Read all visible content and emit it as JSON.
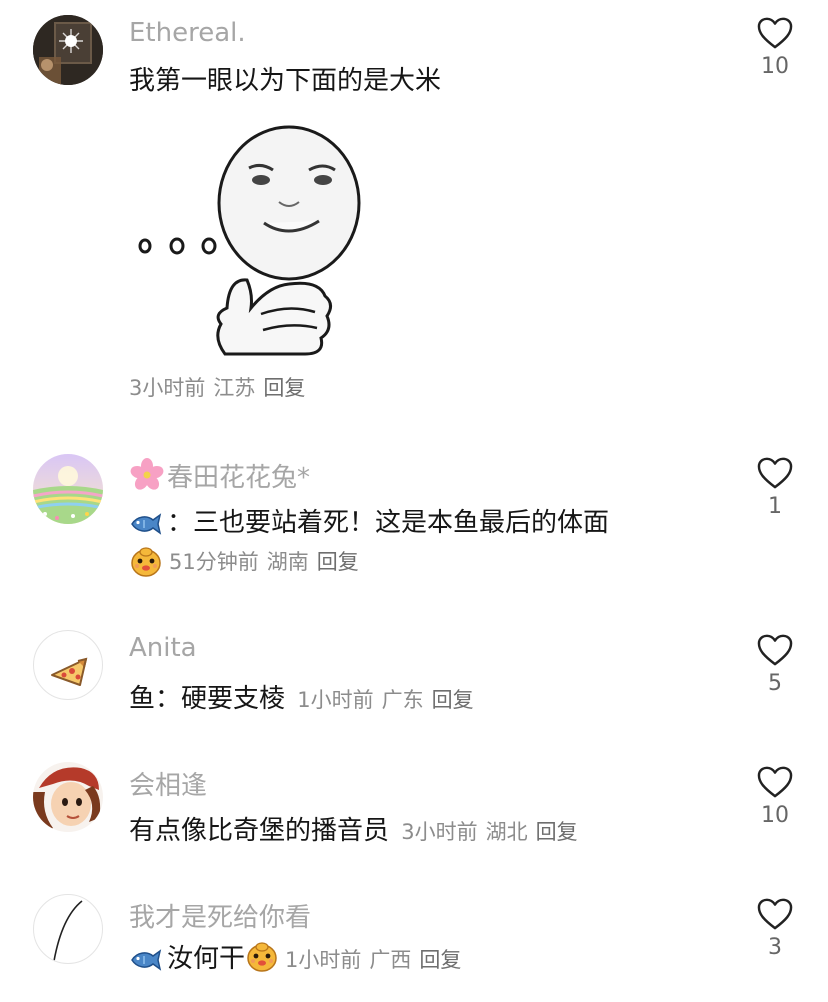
{
  "comments": [
    {
      "username": "Ethereal.",
      "text": "我第一眼以为下面的是大米",
      "time": "3小时前",
      "location": "江苏",
      "reply_label": "回复",
      "likes": "10",
      "avatar_icon": "night-window-avatar",
      "sticker": "thinking-face-sticker"
    },
    {
      "username_prefix_icon": "cherry-blossom-icon",
      "username": "春田花花兔*",
      "text_prefix_icon": "fish-icon",
      "text": "：三也要站着死！这是本鱼最后的体面",
      "meta_prefix_icon": "smiling-face-icon",
      "time": "51分钟前",
      "location": "湖南",
      "reply_label": "回复",
      "likes": "1",
      "avatar_icon": "flower-field-avatar"
    },
    {
      "username": "Anita",
      "text": "鱼：硬要支棱",
      "time": "1小时前",
      "location": "广东",
      "reply_label": "回复",
      "likes": "5",
      "avatar_icon": "pizza-avatar"
    },
    {
      "username": "会相逢",
      "text": "有点像比奇堡的播音员",
      "time": "3小时前",
      "location": "湖北",
      "reply_label": "回复",
      "likes": "10",
      "avatar_icon": "anime-character-avatar"
    },
    {
      "username": "我才是死给你看",
      "text_prefix_icon": "fish-icon",
      "text": "汝何干",
      "text_suffix_icon": "smiling-face-icon",
      "time": "1小时前",
      "location": "广西",
      "reply_label": "回复",
      "likes": "3",
      "avatar_icon": "line-sketch-avatar"
    }
  ],
  "colors": {
    "username": "#a6a6a6",
    "text": "#161616",
    "meta": "#8c8c8c",
    "fish": "#4a86c7",
    "emoji_face": "#f5b83a"
  }
}
